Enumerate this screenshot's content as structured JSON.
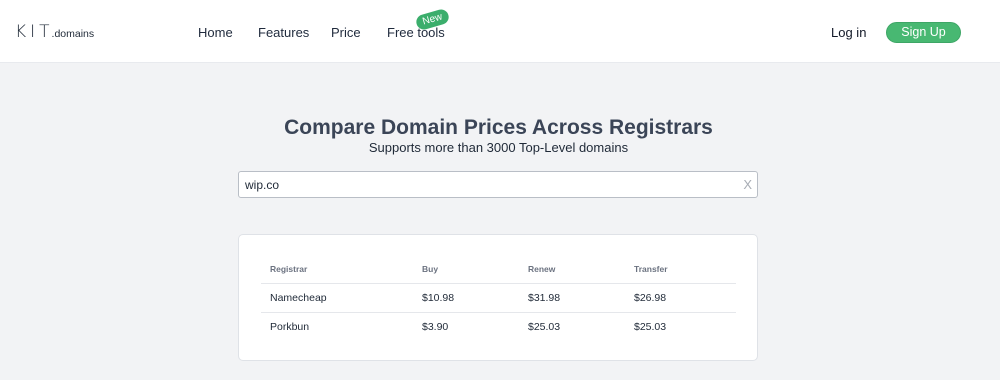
{
  "header": {
    "logo": {
      "main": "KIT",
      "sub": ".domains"
    },
    "nav": [
      {
        "label": "Home"
      },
      {
        "label": "Features"
      },
      {
        "label": "Price"
      },
      {
        "label": "Free tools",
        "badge": "New"
      }
    ],
    "login_label": "Log in",
    "signup_label": "Sign Up"
  },
  "hero": {
    "title": "Compare Domain Prices Across Registrars",
    "subtitle": "Supports more than 3000 Top-Level domains"
  },
  "search": {
    "value": "wip.co",
    "clear_label": "X"
  },
  "table": {
    "columns": [
      "Registrar",
      "Buy",
      "Renew",
      "Transfer"
    ],
    "rows": [
      [
        "Namecheap",
        "$10.98",
        "$31.98",
        "$26.98"
      ],
      [
        "Porkbun",
        "$3.90",
        "$25.03",
        "$25.03"
      ]
    ]
  },
  "colors": {
    "accent": "#48b872",
    "badge": "#3bae6c",
    "title": "#3b4557",
    "background": "#f2f3f5"
  }
}
